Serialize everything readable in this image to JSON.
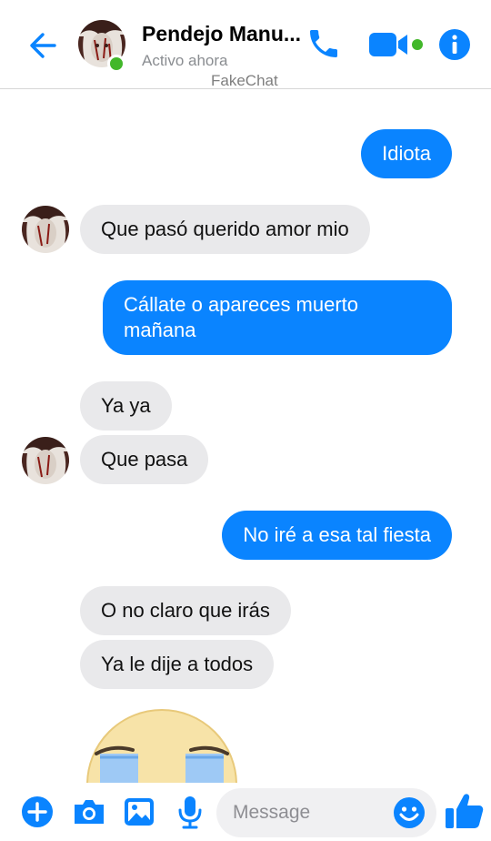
{
  "colors": {
    "accent": "#0a84ff",
    "online": "#42b72a",
    "received_bubble": "#e9e9eb",
    "sent_bubble": "#0a84ff"
  },
  "header": {
    "contact_name": "Pendejo Manu...",
    "status": "Activo ahora",
    "watermark": "FakeChat",
    "icons": [
      "back-arrow-icon",
      "phone-icon",
      "video-camera-icon",
      "info-icon"
    ]
  },
  "messages": [
    {
      "from": "me",
      "text": "Idiota"
    },
    {
      "from": "contact",
      "text": "Que pasó querido amor mio"
    },
    {
      "from": "me",
      "lines": [
        "Cállate o apareces muerto",
        "mañana"
      ]
    },
    {
      "from": "contact",
      "text": "Ya ya"
    },
    {
      "from": "contact",
      "text": "Que pasa"
    },
    {
      "from": "me",
      "text": "No iré a esa tal fiesta"
    },
    {
      "from": "contact",
      "text": "O no claro que irás"
    },
    {
      "from": "contact",
      "text": "Ya le dije a todos"
    },
    {
      "from": "contact",
      "sticker": "crying-face-sticker"
    }
  ],
  "composer": {
    "placeholder": "Message",
    "icons": [
      "plus-icon",
      "camera-icon",
      "image-icon",
      "microphone-icon",
      "emoji-icon",
      "thumbs-up-icon"
    ]
  }
}
